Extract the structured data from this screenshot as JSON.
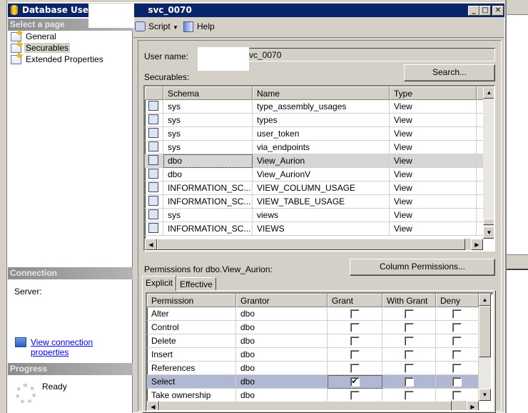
{
  "window": {
    "title_prefix": "Database User - ",
    "title_suffix": "svc_0070",
    "minimize": "_",
    "maximize": "□",
    "close": "✕",
    "title_color": "#0a246a"
  },
  "sidebar": {
    "select_page_header": "Select a page",
    "pages": [
      {
        "label": "General",
        "icon": "page-icon"
      },
      {
        "label": "Securables",
        "icon": "page-icon",
        "selected": true
      },
      {
        "label": "Extended Properties",
        "icon": "page-icon"
      }
    ],
    "connection_header": "Connection",
    "server_label": "Server:",
    "view_connection_link": "View connection properties",
    "progress_header": "Progress",
    "progress_status": "Ready"
  },
  "toolbar": {
    "script_label": "Script",
    "help_label": "Help"
  },
  "form": {
    "user_name_label": "User name:",
    "user_name_value": "svc_0070",
    "securables_label": "Securables:",
    "search_button": "Search..."
  },
  "securables": {
    "columns": [
      "",
      "Schema",
      "Name",
      "Type"
    ],
    "rows": [
      {
        "schema": "sys",
        "name": "type_assembly_usages",
        "type": "View"
      },
      {
        "schema": "sys",
        "name": "types",
        "type": "View"
      },
      {
        "schema": "sys",
        "name": "user_token",
        "type": "View"
      },
      {
        "schema": "sys",
        "name": "via_endpoints",
        "type": "View"
      },
      {
        "schema": "dbo",
        "name": "View_Aurion",
        "type": "View",
        "selected": true
      },
      {
        "schema": "dbo",
        "name": "View_AurionV",
        "type": "View"
      },
      {
        "schema": "INFORMATION_SC...",
        "name": "VIEW_COLUMN_USAGE",
        "type": "View"
      },
      {
        "schema": "INFORMATION_SC...",
        "name": "VIEW_TABLE_USAGE",
        "type": "View"
      },
      {
        "schema": "sys",
        "name": "views",
        "type": "View"
      },
      {
        "schema": "INFORMATION_SC...",
        "name": "VIEWS",
        "type": "View"
      }
    ]
  },
  "permissions": {
    "label": "Permissions for dbo.View_Aurion:",
    "column_permissions_button": "Column Permissions...",
    "tabs": [
      "Explicit",
      "Effective"
    ],
    "active_tab": "Explicit",
    "columns": [
      "Permission",
      "Grantor",
      "Grant",
      "With Grant",
      "Deny"
    ],
    "rows": [
      {
        "permission": "Alter",
        "grantor": "dbo",
        "grant": false,
        "with_grant": false,
        "deny": false
      },
      {
        "permission": "Control",
        "grantor": "dbo",
        "grant": false,
        "with_grant": false,
        "deny": false
      },
      {
        "permission": "Delete",
        "grantor": "dbo",
        "grant": false,
        "with_grant": false,
        "deny": false
      },
      {
        "permission": "Insert",
        "grantor": "dbo",
        "grant": false,
        "with_grant": false,
        "deny": false
      },
      {
        "permission": "References",
        "grantor": "dbo",
        "grant": false,
        "with_grant": false,
        "deny": false
      },
      {
        "permission": "Select",
        "grantor": "dbo",
        "grant": true,
        "with_grant": false,
        "deny": false,
        "selected": true
      },
      {
        "permission": "Take ownership",
        "grantor": "dbo",
        "grant": false,
        "with_grant": false,
        "deny": false
      }
    ]
  }
}
